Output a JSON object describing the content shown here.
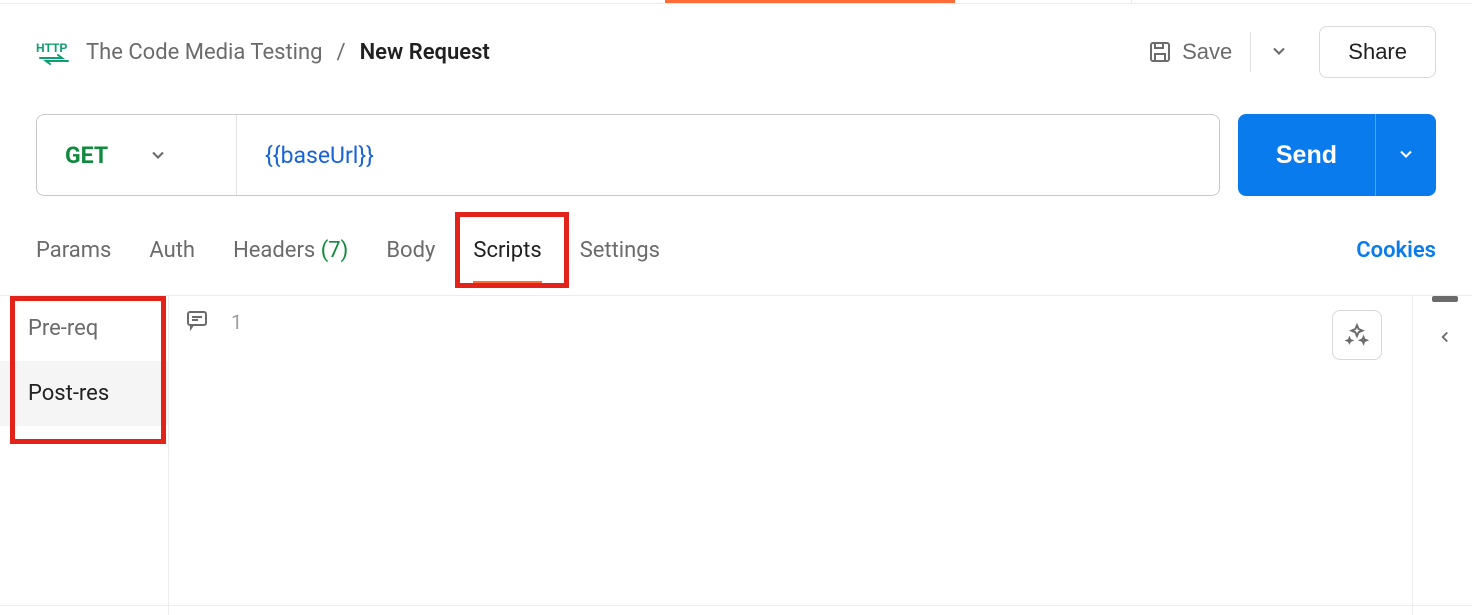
{
  "header": {
    "collection": "The Code Media Testing",
    "separator": "/",
    "request_name": "New Request",
    "save_label": "Save",
    "share_label": "Share"
  },
  "request": {
    "method": "GET",
    "url_variable": "{{baseUrl}}",
    "send_label": "Send"
  },
  "tabs": {
    "params": "Params",
    "auth": "Auth",
    "headers": "Headers",
    "headers_count": "(7)",
    "body": "Body",
    "scripts": "Scripts",
    "settings": "Settings",
    "cookies": "Cookies"
  },
  "script_tabs": {
    "prereq": "Pre-req",
    "postres": "Post-res"
  },
  "editor": {
    "line_number": "1"
  }
}
